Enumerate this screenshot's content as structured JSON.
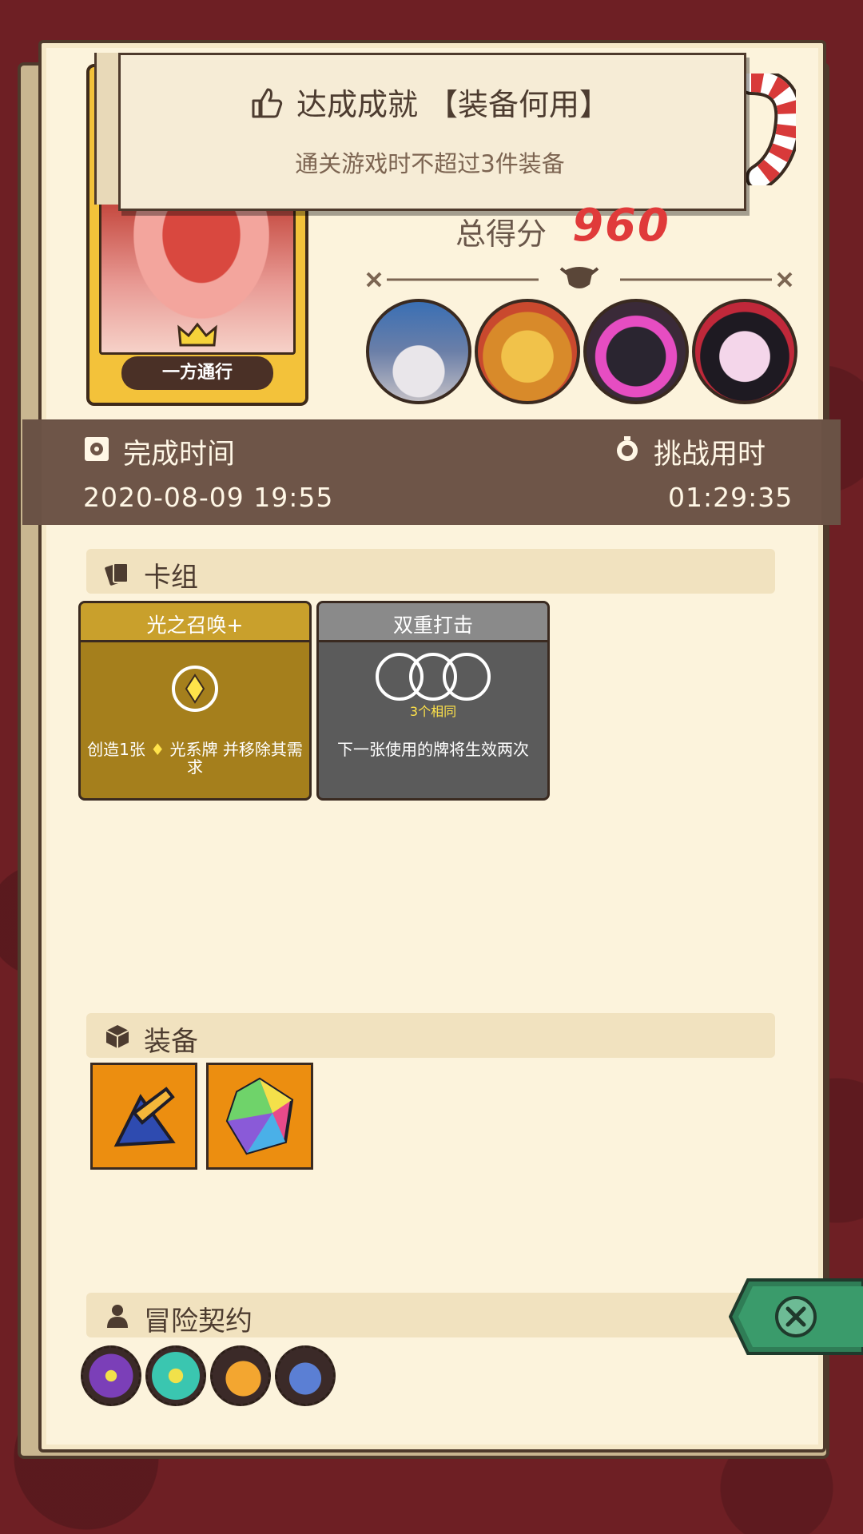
{
  "hero": {
    "label": "一方通行"
  },
  "achievement": {
    "title": "达成成就 【装备何用】",
    "subtitle": "通关游戏时不超过3件装备"
  },
  "score": {
    "label": "总得分",
    "value": "960"
  },
  "bosses": [
    "wizard-boss",
    "orc-boss",
    "shadow-knight-boss",
    "vampire-boss"
  ],
  "completion": {
    "time_label": "完成时间",
    "time_value": "2020-08-09 19:55",
    "duration_label": "挑战用时",
    "duration_value": "01:29:35"
  },
  "sections": {
    "deck": "卡组",
    "equipment": "装备",
    "contracts": "冒险契约"
  },
  "cards": [
    {
      "name": "光之召唤+",
      "desc_prefix": "创造1张",
      "desc_suffix": "光系牌 并移除其需求",
      "color": "#a57f1c"
    },
    {
      "name": "双重打击",
      "requirement": "3个相同",
      "desc": "下一张使用的牌将生效两次",
      "color": "#5b5b5b"
    }
  ],
  "equipment": [
    "crossbow-icon",
    "crystal-gem-icon"
  ],
  "contracts": [
    "purple-crown-icon",
    "cyan-gear-icon",
    "horn-icon",
    "scroll-icon"
  ],
  "colors": {
    "accent_red": "#e03a3a",
    "panel": "#fcf3dc",
    "dark_bar": "#6e5548",
    "close_green": "#3a9b6b"
  }
}
